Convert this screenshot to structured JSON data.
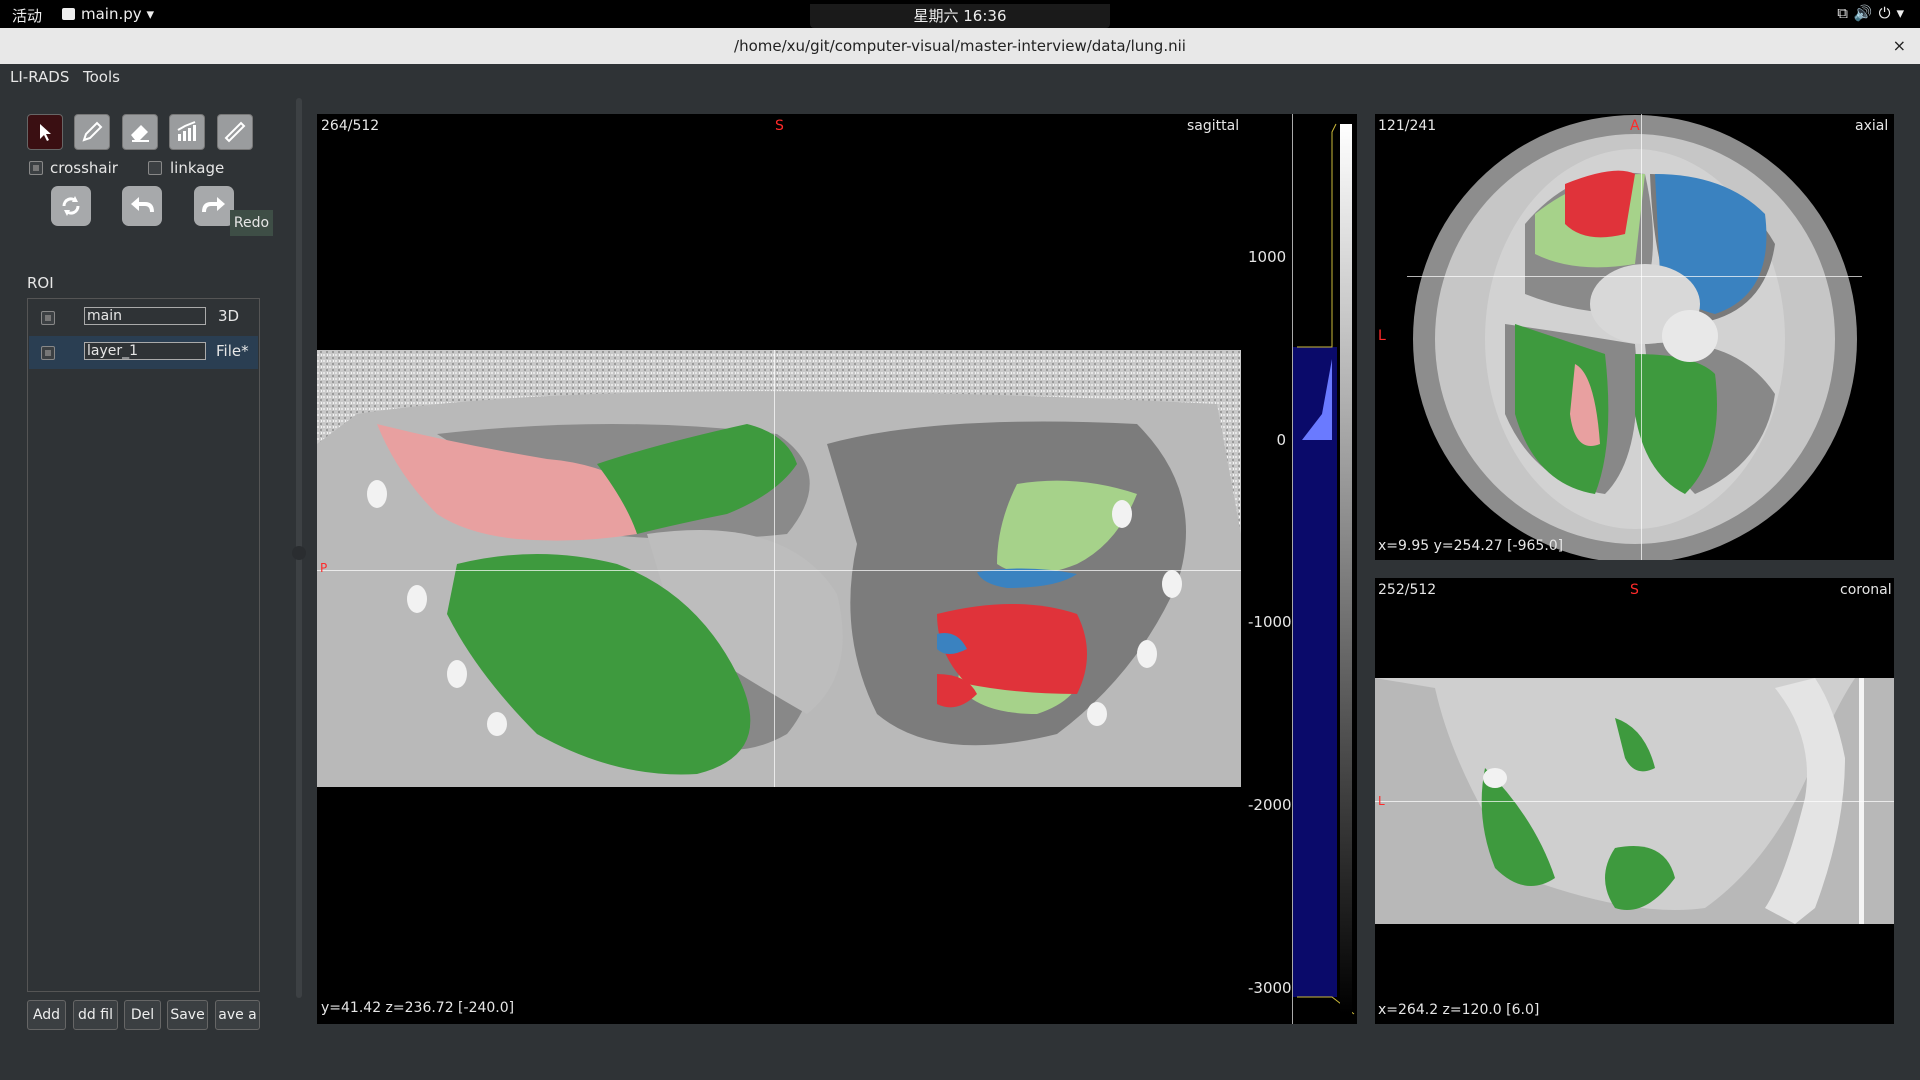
{
  "system_bar": {
    "activities": "活动",
    "app_menu": "main.py",
    "clock": "星期六 16:36"
  },
  "window": {
    "title": "/home/xu/git/computer-visual/master-interview/data/lung.nii",
    "close": "×"
  },
  "menubar": {
    "items": [
      "LI-RADS",
      "Tools"
    ]
  },
  "toolbar": {
    "tools": [
      {
        "name": "pointer",
        "active": true
      },
      {
        "name": "pencil",
        "active": false
      },
      {
        "name": "eraser",
        "active": false
      },
      {
        "name": "histogram",
        "active": false
      },
      {
        "name": "ruler",
        "active": false
      }
    ],
    "crosshair_label": "crosshair",
    "crosshair_checked": true,
    "linkage_label": "linkage",
    "linkage_checked": false,
    "redo_tooltip": "Redo"
  },
  "roi": {
    "heading": "ROI",
    "layers": [
      {
        "name": "main",
        "tag": "3D",
        "selected": false,
        "checked": true
      },
      {
        "name": "layer_1",
        "tag": "File*",
        "selected": true,
        "checked": true
      }
    ],
    "buttons": [
      "Add",
      "dd fil",
      "Del",
      "Save",
      "ave a"
    ]
  },
  "views": {
    "sagittal": {
      "slice": "264/512",
      "name": "sagittal",
      "top_orient": "S",
      "left_orient": "P",
      "coords": "y=41.42   z=236.72   [-240.0]"
    },
    "axial": {
      "slice": "121/241",
      "name": "axial",
      "top_orient": "A",
      "left_orient": "L",
      "coords": "x=9.95   y=254.27   [-965.0]"
    },
    "coronal": {
      "slice": "252/512",
      "name": "coronal",
      "top_orient": "S",
      "left_orient": "L",
      "coords": "x=264.2   z=120.0    [6.0]"
    }
  },
  "colorbar": {
    "ticks": [
      "1000",
      "0",
      "-1000",
      "-2000",
      "-3000"
    ]
  },
  "colors": {
    "green": "#3e9a3e",
    "light_green": "#a6d28a",
    "pink": "#e8a0a0",
    "red": "#e0333a",
    "blue": "#3a82c0"
  }
}
